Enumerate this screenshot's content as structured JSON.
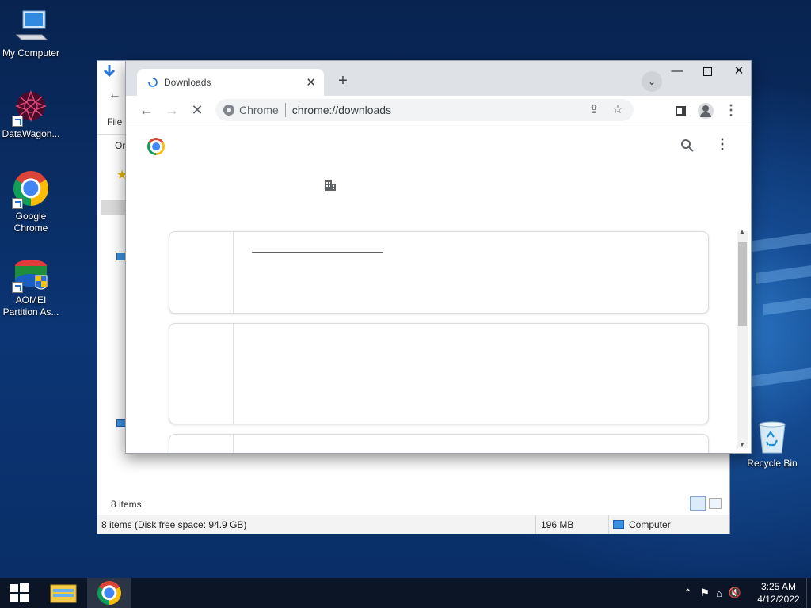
{
  "desktop": {
    "icons": [
      {
        "label": "My Computer"
      },
      {
        "label": "DataWagon..."
      },
      {
        "label": "Google Chrome"
      },
      {
        "label": "AOMEI Partition As..."
      },
      {
        "label": "Recycle Bin"
      }
    ]
  },
  "explorer": {
    "menu_file": "File",
    "toolbar_org": "Org",
    "status_items": "8 items",
    "status_disk": "8 items (Disk free space: 94.9 GB)",
    "status_size": "196 MB",
    "status_location": "Computer"
  },
  "chrome": {
    "tab_title": "Downloads",
    "tab_close": "✕",
    "new_tab": "+",
    "site_label": "Chrome",
    "url": "chrome://downloads"
  },
  "taskbar": {
    "time": "3:25 AM",
    "date": "4/12/2022"
  },
  "colors": {
    "chrome_red": "#db4437",
    "chrome_yellow": "#fbbc05",
    "chrome_green": "#0f9d58",
    "chrome_blue": "#4285f4",
    "taskbar": "#0c1526"
  }
}
